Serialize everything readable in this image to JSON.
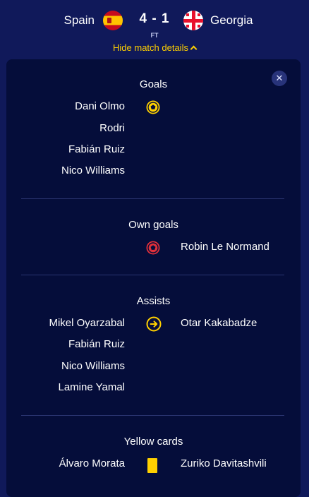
{
  "header": {
    "home_team": "Spain",
    "away_team": "Georgia",
    "score": "4 - 1",
    "status": "FT",
    "toggle_label": "Hide match details"
  },
  "panel": {
    "close_label": "✕",
    "goals": {
      "title": "Goals",
      "home": [
        "Dani Olmo",
        "Rodri",
        "Fabián Ruiz",
        "Nico Williams"
      ],
      "away": []
    },
    "own_goals": {
      "title": "Own goals",
      "home": [],
      "away": [
        "Robin Le Normand"
      ]
    },
    "assists": {
      "title": "Assists",
      "home": [
        "Mikel Oyarzabal",
        "Fabián Ruiz",
        "Nico Williams",
        "Lamine Yamal"
      ],
      "away": [
        "Otar Kakabadze"
      ]
    },
    "yellow_cards": {
      "title": "Yellow cards",
      "home": [
        "Álvaro Morata"
      ],
      "away": [
        "Zuriko Davitashvili"
      ]
    }
  },
  "colors": {
    "background": "#10195a",
    "panel": "#050d3a",
    "accent": "#ffd000",
    "own_goal": "#e0303a"
  }
}
